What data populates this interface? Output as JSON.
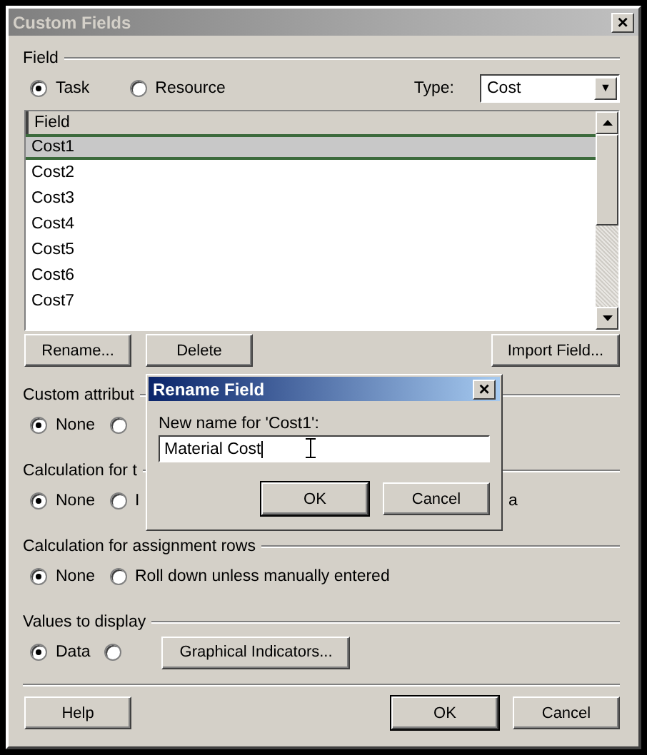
{
  "window": {
    "title": "Custom Fields",
    "close": "×"
  },
  "field_group": {
    "label": "Field",
    "scope_options": [
      {
        "label": "Task",
        "selected": true
      },
      {
        "label": "Resource",
        "selected": false
      }
    ],
    "type_label": "Type:",
    "type_value": "Cost",
    "dropdown_arrow": "▼",
    "table": {
      "columns": [
        "Field"
      ],
      "rows": [
        {
          "cell": "Cost1",
          "selected": true
        },
        {
          "cell": "Cost2",
          "selected": false
        },
        {
          "cell": "Cost3",
          "selected": false
        },
        {
          "cell": "Cost4",
          "selected": false
        },
        {
          "cell": "Cost5",
          "selected": false
        },
        {
          "cell": "Cost6",
          "selected": false
        },
        {
          "cell": "Cost7",
          "selected": false
        }
      ]
    },
    "buttons": [
      "Rename...",
      "Delete",
      "Import Field..."
    ]
  },
  "sections": [
    {
      "label": "Custom attribut",
      "options": [
        {
          "label": "None",
          "selected": true
        },
        {
          "selected": false
        }
      ]
    },
    {
      "label": "Calculation for t",
      "options": [
        {
          "label": "None",
          "selected": true
        },
        {
          "label": "I",
          "selected": false
        }
      ],
      "tail": "a"
    },
    {
      "label": "Calculation for assignment rows",
      "options": [
        {
          "label": "None",
          "selected": true
        },
        {
          "label": "Roll down unless manually entered",
          "selected": false
        }
      ]
    },
    {
      "label": "Values to display",
      "options": [
        {
          "label": "Data",
          "selected": true
        },
        {
          "selected": false
        }
      ],
      "button": "Graphical Indicators..."
    }
  ],
  "footer_buttons": [
    {
      "label": "Help",
      "default": false
    },
    {
      "label": "OK",
      "default": true
    },
    {
      "label": "Cancel",
      "default": false
    }
  ],
  "rename_dialog": {
    "title": "Rename Field",
    "close": "×",
    "prompt": "New name for 'Cost1':",
    "value": "Material Cost",
    "buttons": [
      {
        "label": "OK",
        "default": true
      },
      {
        "label": "Cancel",
        "default": false
      }
    ]
  }
}
